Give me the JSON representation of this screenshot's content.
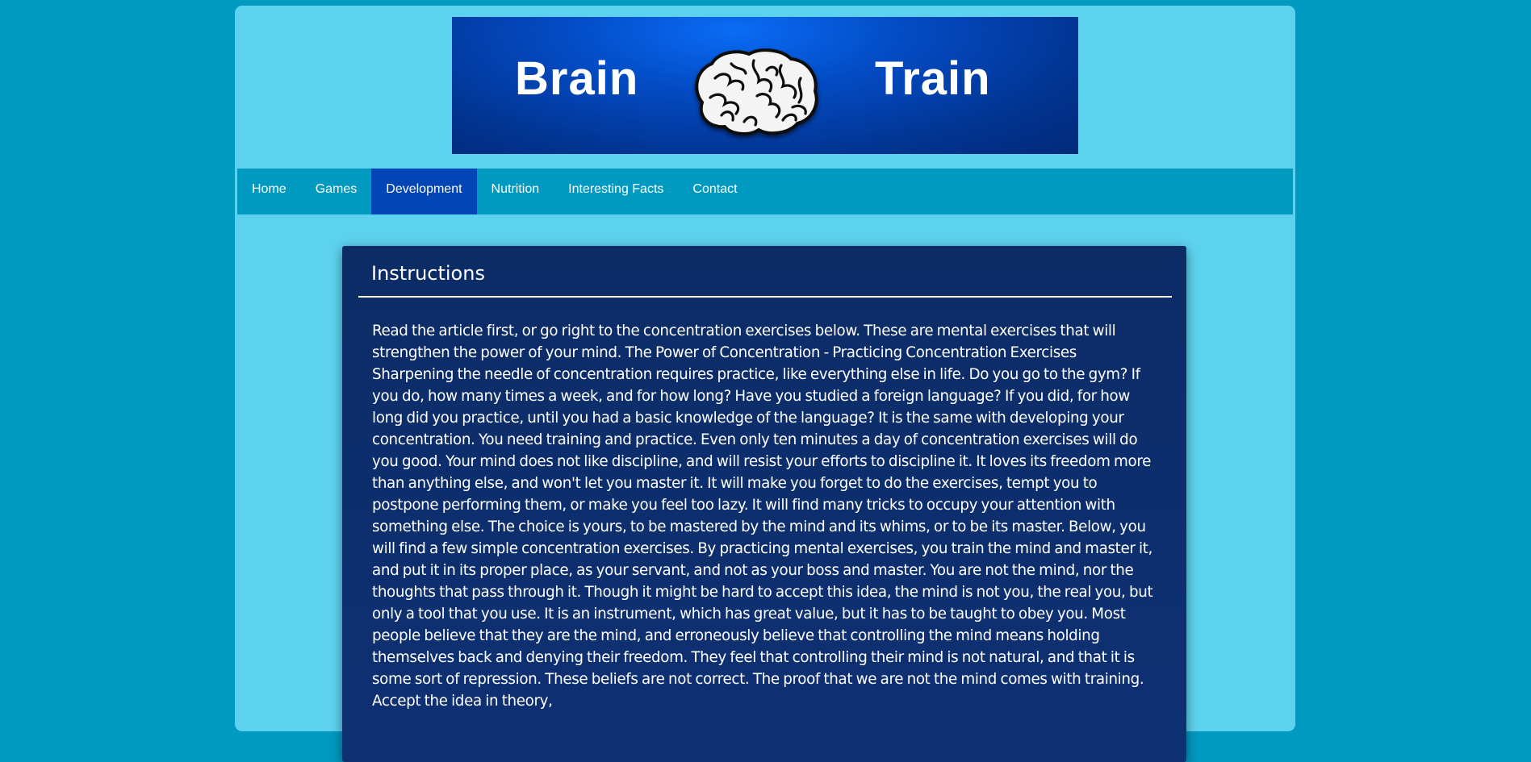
{
  "banner": {
    "left_word": "Brain",
    "right_word": "Train",
    "logo_icon": "brain-icon"
  },
  "nav": {
    "items": [
      {
        "label": "Home",
        "active": false
      },
      {
        "label": "Games",
        "active": false
      },
      {
        "label": "Development",
        "active": true
      },
      {
        "label": "Nutrition",
        "active": false
      },
      {
        "label": "Interesting Facts",
        "active": false
      },
      {
        "label": "Contact",
        "active": false
      }
    ]
  },
  "card": {
    "title": "Instructions",
    "body": "Read the article first, or go right to the concentration exercises below. These are mental exercises that will strengthen the power of your mind. The Power of Concentration - Practicing Concentration Exercises Sharpening the needle of concentration requires practice, like everything else in life. Do you go to the gym? If you do, how many times a week, and for how long? Have you studied a foreign language? If you did, for how long did you practice, until you had a basic knowledge of the language? It is the same with developing your concentration. You need training and practice. Even only ten minutes a day of concentration exercises will do you good. Your mind does not like discipline, and will resist your efforts to discipline it. It loves its freedom more than anything else, and won't let you master it. It will make you forget to do the exercises, tempt you to postpone performing them, or make you feel too lazy. It will find many tricks to occupy your attention with something else. The choice is yours, to be mastered by the mind and its whims, or to be its master. Below, you will find a few simple concentration exercises. By practicing mental exercises, you train the mind and master it, and put it in its proper place, as your servant, and not as your boss and master. You are not the mind, nor the thoughts that pass through it. Though it might be hard to accept this idea, the mind is not you, the real you, but only a tool that you use. It is an instrument, which has great value, but it has to be taught to obey you. Most people believe that they are the mind, and erroneously believe that controlling the mind means holding themselves back and denying their freedom. They feel that controlling their mind is not natural, and that it is some sort of repression. These beliefs are not correct. The proof that we are not the mind comes with training. Accept the idea in theory,"
  },
  "colors": {
    "background": "#0099c0",
    "page": "#5dd2ef",
    "nav": "#0099c0",
    "nav_active": "#0245b5",
    "card": "#0c2c66",
    "text": "#ffffff"
  }
}
